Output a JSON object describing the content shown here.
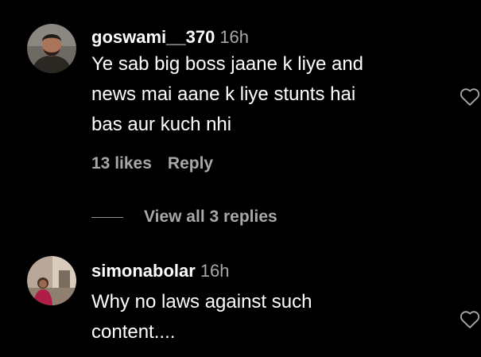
{
  "comments": [
    {
      "username": "goswami__370",
      "timestamp": "16h",
      "lines": [
        "Ye sab big boss jaane k liye and",
        "news mai aane k liye stunts hai",
        "bas aur kuch nhi"
      ],
      "likes": "13 likes",
      "reply_label": "Reply",
      "view_replies": "View all 3 replies",
      "like_icon": "heart-outline-icon"
    },
    {
      "username": "simonabolar",
      "timestamp": "16h",
      "lines": [
        "Why no laws against such",
        "content...."
      ],
      "like_icon": "heart-outline-icon"
    }
  ],
  "colors": {
    "background": "#000000",
    "text_primary": "#ffffff",
    "text_secondary": "#a8a8a8"
  }
}
